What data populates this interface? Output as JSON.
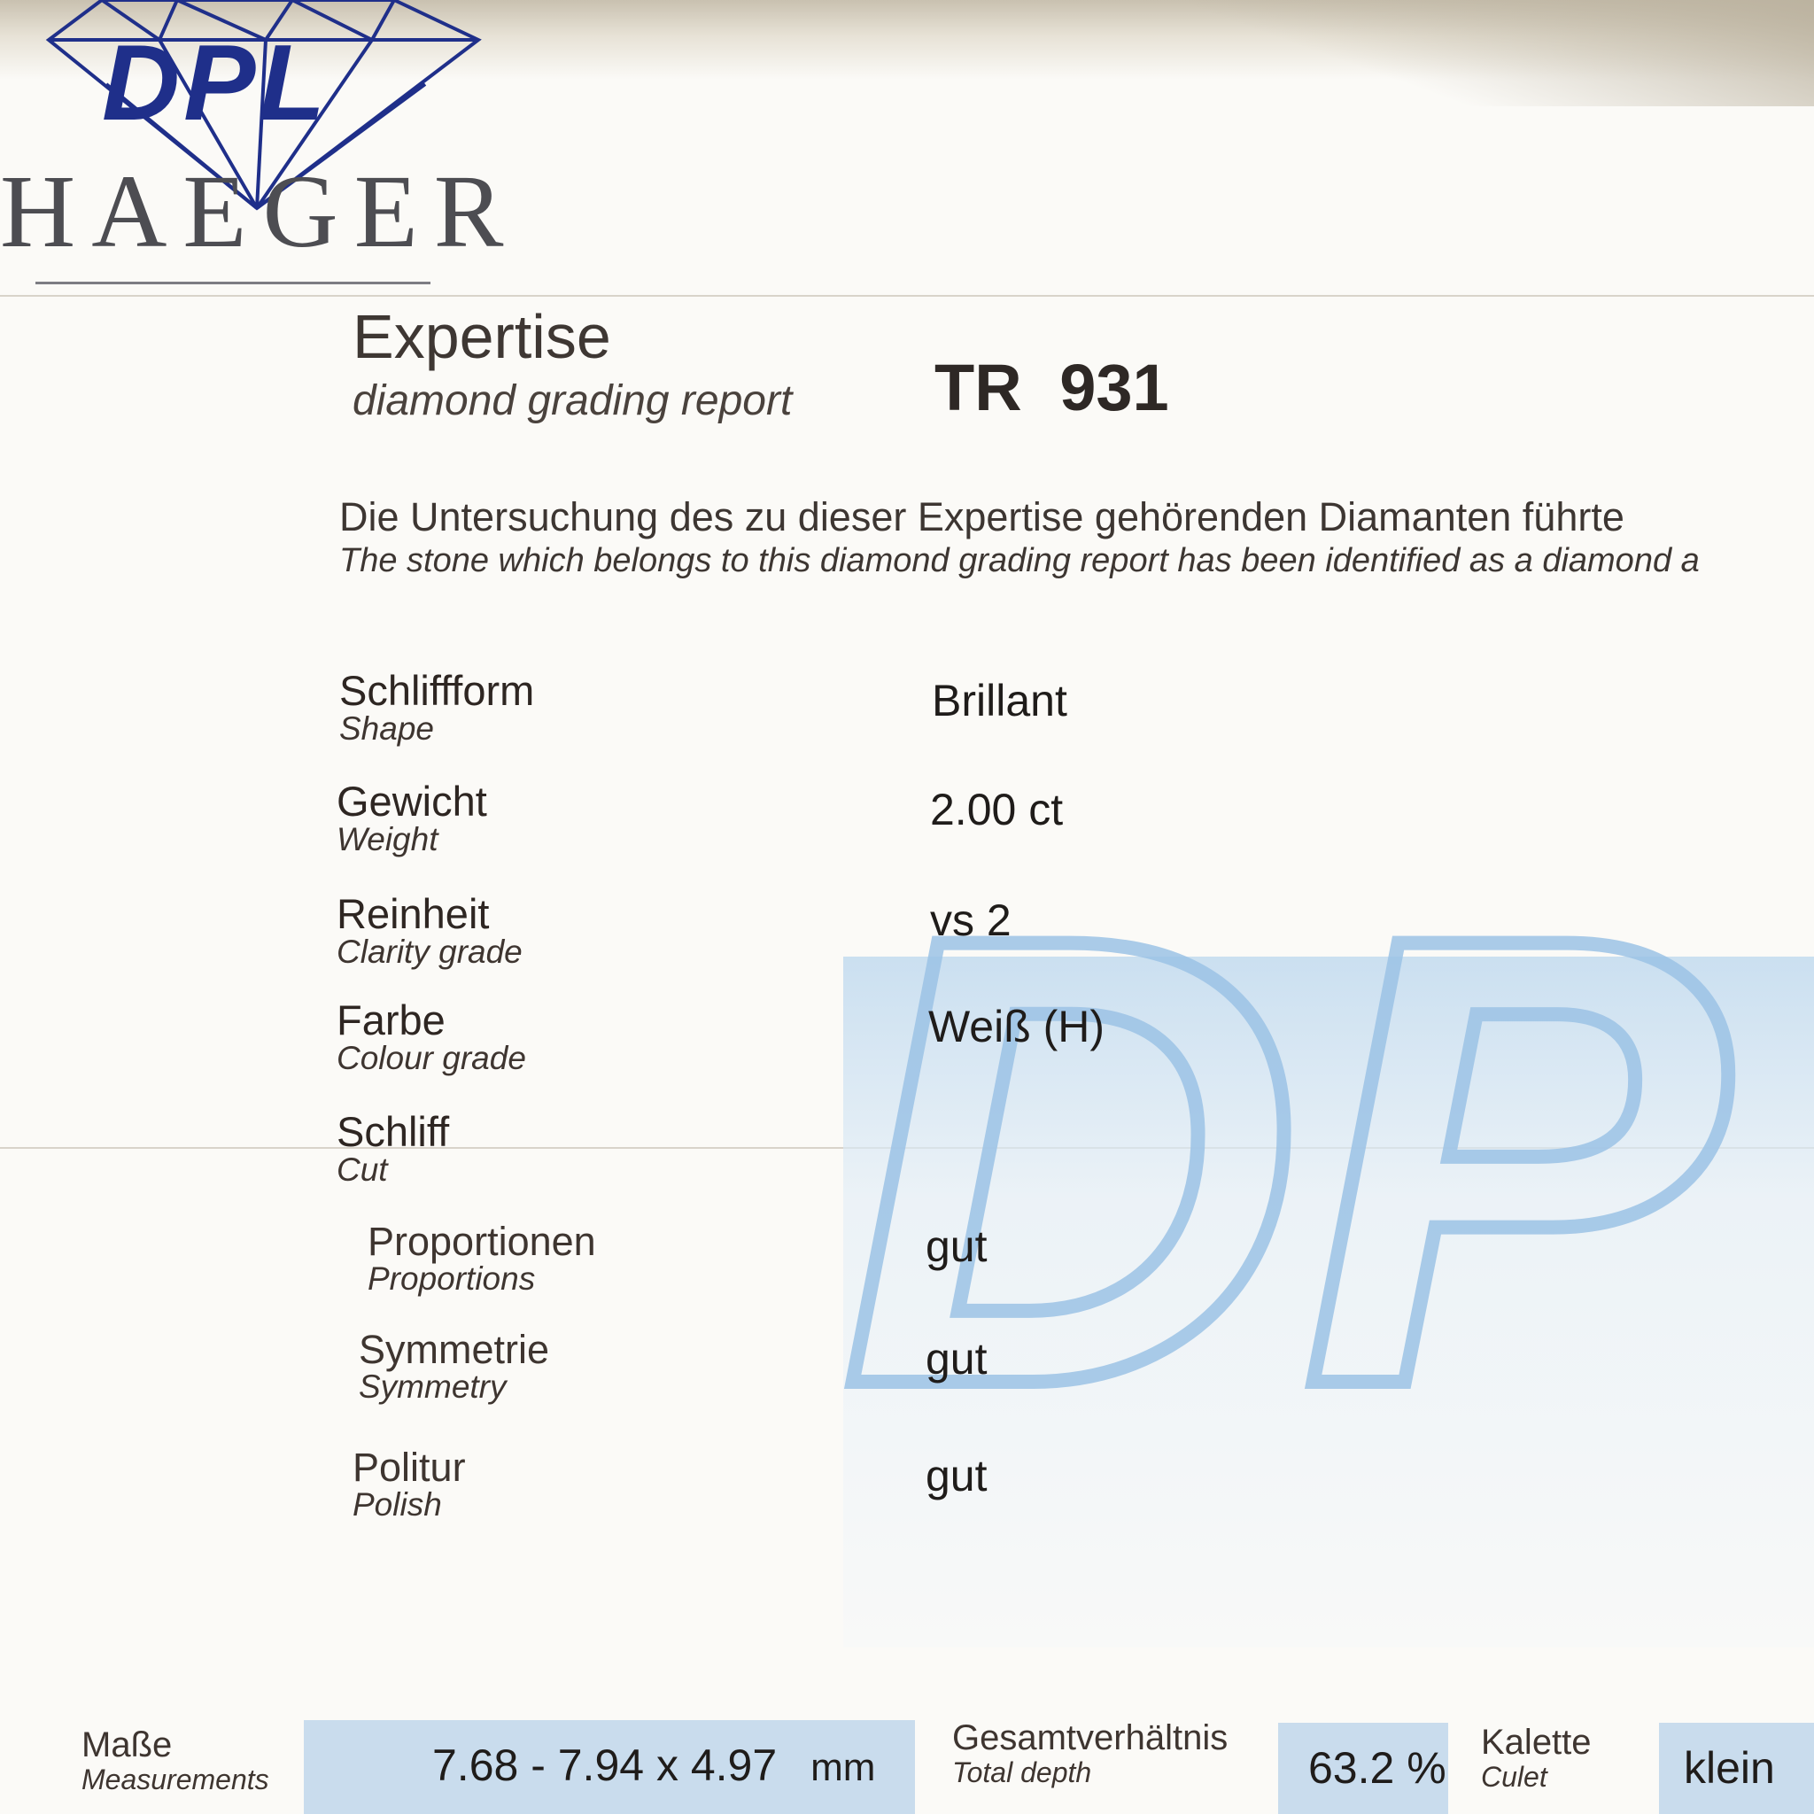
{
  "brand": {
    "logo_text": "DPL",
    "name": "HAEGER",
    "logo_icon": "diamond-outline-icon",
    "accent_color": "#1f2f8a"
  },
  "header": {
    "title": "Expertise",
    "subtitle": "diamond grading report",
    "report_number": "TR 931"
  },
  "intro": {
    "de": "Die Untersuchung des zu dieser Expertise gehörenden Diamanten führte",
    "en": "The stone which belongs to this diamond grading report has been identified as a diamond a"
  },
  "fields": [
    {
      "de": "Schliffform",
      "en": "Shape",
      "value": "Brillant"
    },
    {
      "de": "Gewicht",
      "en": "Weight",
      "value": "2.00 ct"
    },
    {
      "de": "Reinheit",
      "en": "Clarity grade",
      "value": "vs 2"
    },
    {
      "de": "Farbe",
      "en": "Colour grade",
      "value": "Weiß (H)"
    },
    {
      "de": "Schliff",
      "en": "Cut",
      "value": ""
    }
  ],
  "cut_details": [
    {
      "de": "Proportionen",
      "en": "Proportions",
      "value": "gut"
    },
    {
      "de": "Symmetrie",
      "en": "Symmetry",
      "value": "gut"
    },
    {
      "de": "Politur",
      "en": "Polish",
      "value": "gut"
    }
  ],
  "bottom": {
    "measurements": {
      "de": "Maße",
      "en": "Measurements",
      "value": "7.68 - 7.94 x 4.97",
      "unit": "mm"
    },
    "total_depth": {
      "de": "Gesamtverhältnis",
      "en": "Total depth",
      "value": "63.2 %"
    },
    "culet": {
      "de": "Kalette",
      "en": "Culet",
      "value": "klein"
    }
  },
  "watermark_text": "DP",
  "colors": {
    "paper": "#fbfaf7",
    "value_box": "#c9dced",
    "watermark_blue": "#9cc3e6"
  }
}
